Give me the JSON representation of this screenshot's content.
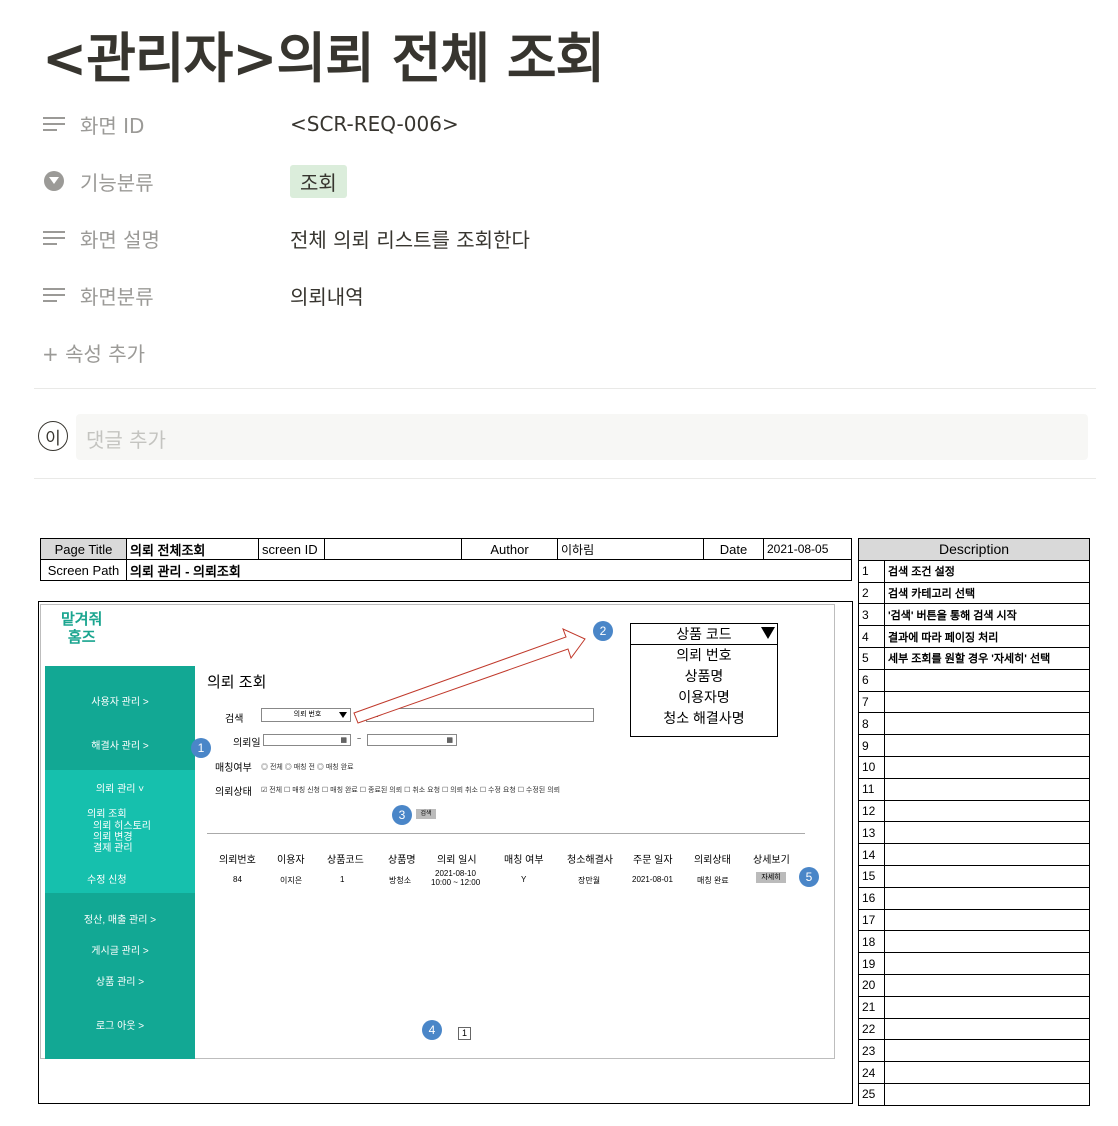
{
  "page": {
    "title": "<관리자>의뢰 전체 조회",
    "properties": [
      {
        "name": "화면 ID",
        "value": "<SCR-REQ-006>"
      },
      {
        "name": "기능분류",
        "value": "조회"
      },
      {
        "name": "화면 설명",
        "value": "전체 의뢰 리스트를 조회한다"
      },
      {
        "name": "화면분류",
        "value": "의뢰내역"
      }
    ],
    "add_property": "+ 속성 추가",
    "comment_avatar": "이",
    "comment_placeholder": "댓글 추가"
  },
  "storyboard": {
    "page_title_label": "Page Title",
    "page_title": "의뢰 전체조회",
    "screen_id_label": "screen ID",
    "screen_id": "",
    "author_label": "Author",
    "author": "이하림",
    "date_label": "Date",
    "date": "2021-08-05",
    "screen_path_label": "Screen Path",
    "screen_path": "의뢰 관리 - 의뢰조회"
  },
  "mock": {
    "logo_line1": "맡겨줘",
    "logo_line2": "홈즈",
    "sidebar": {
      "user_mgmt": "사용자 관리    >",
      "solver_mgmt": "해결사 관리    >",
      "request_mgmt": "의뢰 관리    ˅",
      "request_view": "의뢰 조회",
      "request_history": "의뢰 히스토리",
      "request_change": "의뢰 변경",
      "payment_mgmt": "결제 관리",
      "modify_request": "수정 신청",
      "settlement": "정산, 매출 관리   >",
      "board": "게시글 관리    >",
      "product": "상품 관리    >",
      "logout": "로그 아웃    >"
    },
    "section_title": "의뢰 조회",
    "search_label": "검색",
    "search_select": "의뢰 번호",
    "search_value": "84",
    "date_label": "의뢰일",
    "date_sep": "~",
    "match_label": "매칭여부",
    "match_options": "◎ 전체    ◎ 매칭 전    ◎ 매칭 완료",
    "status_label": "의뢰상태",
    "status_options": "☑ 전체    ☐ 매칭 신청     ☐ 매칭 완료     ☐ 종료된 의뢰     ☐ 취소 요청     ☐ 의뢰 취소     ☐ 수정 요청     ☐ 수정된 의뢰",
    "search_button": "검색",
    "columns": [
      "의뢰번호",
      "이용자",
      "상품코드",
      "상품명",
      "의뢰 일시",
      "매칭 여부",
      "청소해결사",
      "주문 일자",
      "의뢰상태",
      "상세보기"
    ],
    "row": {
      "no": "84",
      "user": "이지은",
      "code": "1",
      "product": "방청소",
      "datetime1": "2021-08-10",
      "datetime2": "10:00 ~ 12:00",
      "matched": "Y",
      "solver": "장만월",
      "order_date": "2021-08-01",
      "status": "매칭 완료",
      "detail": "자세히"
    },
    "page_number": "1",
    "dropdown": {
      "selected": "상품 코드",
      "options": [
        "의뢰 번호",
        "상품명",
        "이용자명",
        "청소 해결사명"
      ]
    },
    "badges": [
      "1",
      "2",
      "3",
      "4",
      "5"
    ]
  },
  "description": {
    "header": "Description",
    "rows": [
      {
        "n": "1",
        "t": "검색 조건 설정"
      },
      {
        "n": "2",
        "t": "검색 카테고리 선택"
      },
      {
        "n": "3",
        "t": "'검색' 버튼을 통해 검색 시작"
      },
      {
        "n": "4",
        "t": "결과에 따라 페이징 처리"
      },
      {
        "n": "5",
        "t": "세부 조회를 원할 경우 '자세히' 선택"
      },
      {
        "n": "6",
        "t": ""
      },
      {
        "n": "7",
        "t": ""
      },
      {
        "n": "8",
        "t": ""
      },
      {
        "n": "9",
        "t": ""
      },
      {
        "n": "10",
        "t": ""
      },
      {
        "n": "11",
        "t": ""
      },
      {
        "n": "12",
        "t": ""
      },
      {
        "n": "13",
        "t": ""
      },
      {
        "n": "14",
        "t": ""
      },
      {
        "n": "15",
        "t": ""
      },
      {
        "n": "16",
        "t": ""
      },
      {
        "n": "17",
        "t": ""
      },
      {
        "n": "18",
        "t": ""
      },
      {
        "n": "19",
        "t": ""
      },
      {
        "n": "20",
        "t": ""
      },
      {
        "n": "21",
        "t": ""
      },
      {
        "n": "22",
        "t": ""
      },
      {
        "n": "23",
        "t": ""
      },
      {
        "n": "24",
        "t": ""
      },
      {
        "n": "25",
        "t": ""
      }
    ]
  }
}
